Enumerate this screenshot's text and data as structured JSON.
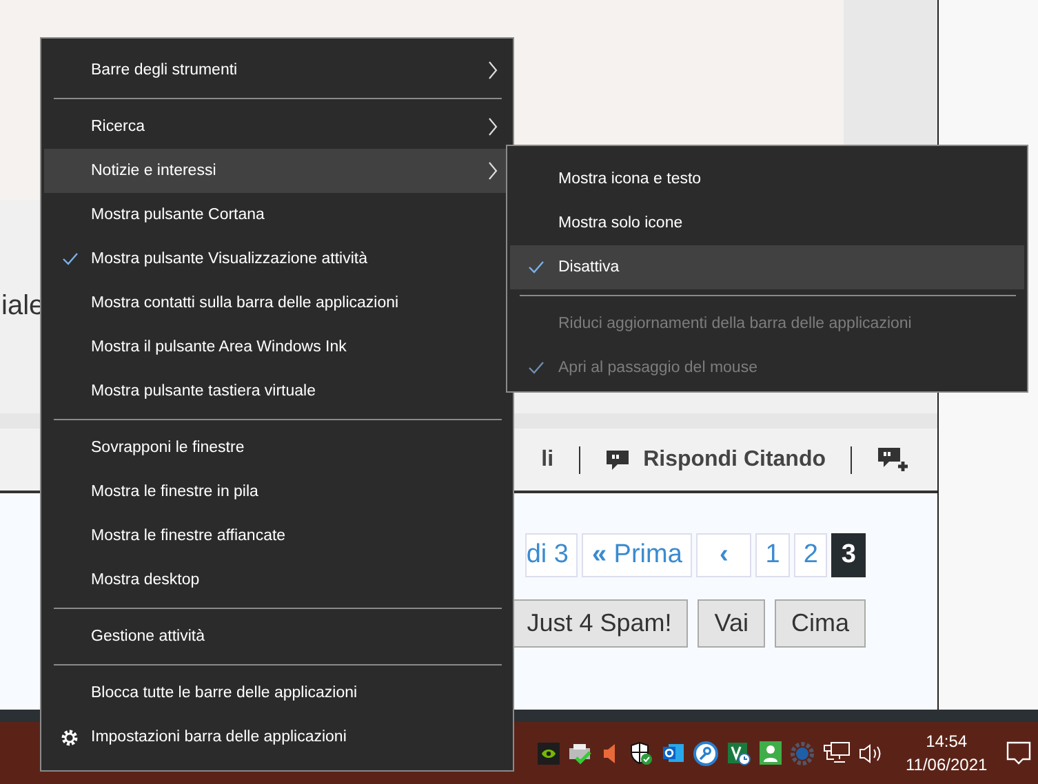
{
  "page": {
    "fragment_text": "iale",
    "toolbar": {
      "item_1": "li",
      "reply_quote": "Rispondi Citando"
    },
    "pagination": {
      "page_info": "di 3",
      "first_glyph": "«",
      "first": "Prima",
      "prev": "‹",
      "pages": [
        {
          "label": "1",
          "selected": false
        },
        {
          "label": "2",
          "selected": false
        },
        {
          "label": "3",
          "selected": true
        }
      ]
    },
    "forum_select": "Just 4 Spam!",
    "buttons": [
      "Vai",
      "Cima"
    ]
  },
  "context_menu": {
    "items": [
      {
        "kind": "item",
        "label": "Barre degli strumenti",
        "submenu": true,
        "checked": false,
        "highlighted": false
      },
      {
        "kind": "separator"
      },
      {
        "kind": "item",
        "label": "Ricerca",
        "submenu": true,
        "checked": false,
        "highlighted": false
      },
      {
        "kind": "item",
        "label": "Notizie e interessi",
        "submenu": true,
        "checked": false,
        "highlighted": true
      },
      {
        "kind": "item",
        "label": "Mostra pulsante Cortana",
        "submenu": false,
        "checked": false,
        "highlighted": false
      },
      {
        "kind": "item",
        "label": "Mostra pulsante Visualizzazione attività",
        "submenu": false,
        "checked": true,
        "highlighted": false
      },
      {
        "kind": "item",
        "label": "Mostra contatti sulla barra delle applicazioni",
        "submenu": false,
        "checked": false,
        "highlighted": false
      },
      {
        "kind": "item",
        "label": "Mostra il pulsante Area Windows Ink",
        "submenu": false,
        "checked": false,
        "highlighted": false
      },
      {
        "kind": "item",
        "label": "Mostra pulsante tastiera virtuale",
        "submenu": false,
        "checked": false,
        "highlighted": false
      },
      {
        "kind": "separator"
      },
      {
        "kind": "item",
        "label": "Sovrapponi le finestre",
        "submenu": false,
        "checked": false,
        "highlighted": false
      },
      {
        "kind": "item",
        "label": "Mostra le finestre in pila",
        "submenu": false,
        "checked": false,
        "highlighted": false
      },
      {
        "kind": "item",
        "label": "Mostra le finestre affiancate",
        "submenu": false,
        "checked": false,
        "highlighted": false
      },
      {
        "kind": "item",
        "label": "Mostra desktop",
        "submenu": false,
        "checked": false,
        "highlighted": false
      },
      {
        "kind": "separator"
      },
      {
        "kind": "item",
        "label": "Gestione attività",
        "submenu": false,
        "checked": false,
        "highlighted": false
      },
      {
        "kind": "separator"
      },
      {
        "kind": "item",
        "label": "Blocca tutte le barre delle applicazioni",
        "submenu": false,
        "checked": false,
        "highlighted": false
      },
      {
        "kind": "settings",
        "label": "Impostazioni barra delle applicazioni",
        "submenu": false,
        "checked": false,
        "highlighted": false
      }
    ]
  },
  "submenu": {
    "items": [
      {
        "kind": "item",
        "label": "Mostra icona e testo",
        "selected": false,
        "disabled": false,
        "highlighted": false
      },
      {
        "kind": "item",
        "label": "Mostra solo icone",
        "selected": false,
        "disabled": false,
        "highlighted": false
      },
      {
        "kind": "item",
        "label": "Disattiva",
        "selected": true,
        "disabled": false,
        "highlighted": true
      },
      {
        "kind": "separator"
      },
      {
        "kind": "item",
        "label": "Riduci aggiornamenti della barra delle applicazioni",
        "selected": false,
        "disabled": true,
        "highlighted": false
      },
      {
        "kind": "item",
        "label": "Apri al passaggio del mouse",
        "selected": true,
        "disabled": true,
        "highlighted": false
      }
    ]
  },
  "taskbar": {
    "time": "14:54",
    "date": "11/06/2021"
  }
}
